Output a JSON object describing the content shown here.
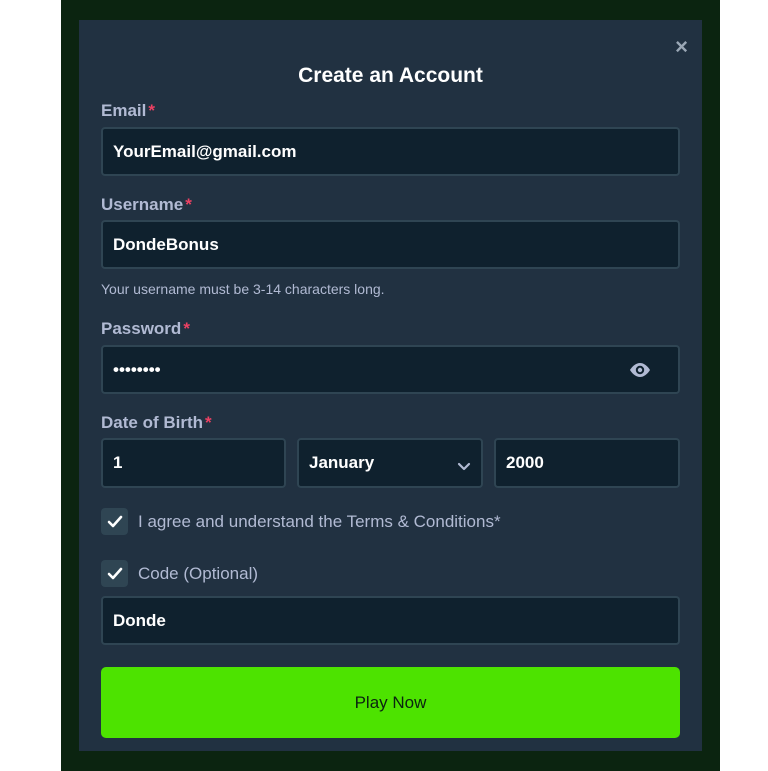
{
  "modal": {
    "title": "Create an Account",
    "close_glyph": "×"
  },
  "email": {
    "label": "Email",
    "required_mark": "*",
    "value": "YourEmail@gmail.com"
  },
  "username": {
    "label": "Username",
    "required_mark": "*",
    "value": "DondeBonus",
    "hint": "Your username must be 3-14 characters long."
  },
  "password": {
    "label": "Password",
    "required_mark": "*",
    "value": "••••••••",
    "toggle_icon": "eye-icon"
  },
  "dob": {
    "label": "Date of Birth",
    "required_mark": "*",
    "day": "1",
    "month": "January",
    "year": "2000"
  },
  "terms": {
    "label": "I agree and understand the Terms & Conditions*",
    "checked": true
  },
  "code": {
    "label": "Code (Optional)",
    "checked": true,
    "value": "Donde"
  },
  "submit": {
    "label": "Play Now"
  },
  "colors": {
    "accent": "#4de300",
    "modal_bg": "#213141",
    "input_bg": "#0f212e",
    "required": "#ed4163"
  }
}
